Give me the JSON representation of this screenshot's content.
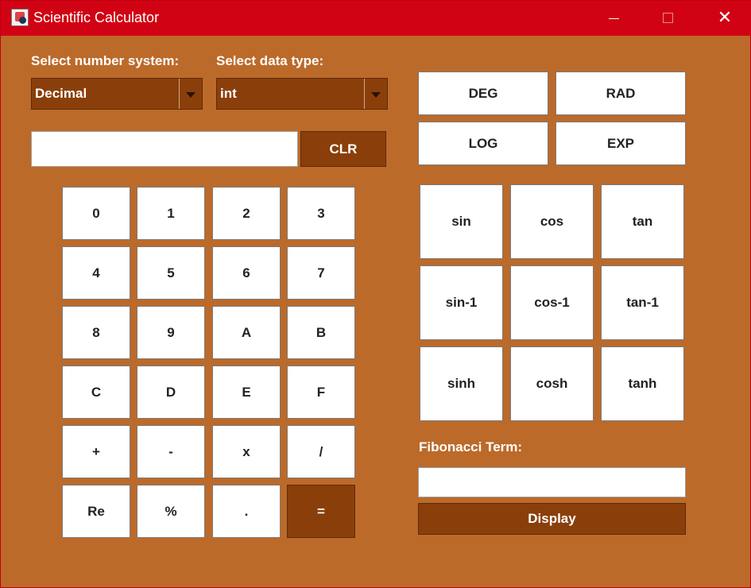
{
  "window": {
    "title": "Scientific Calculator",
    "minimize": "—",
    "maximize": "□",
    "close": "✕"
  },
  "selectors": {
    "number_system": {
      "label": "Select number system:",
      "value": "Decimal"
    },
    "data_type": {
      "label": "Select data type:",
      "value": "int"
    }
  },
  "display": {
    "value": "",
    "clear_label": "CLR"
  },
  "keypad": [
    [
      "0",
      "1",
      "2",
      "3"
    ],
    [
      "4",
      "5",
      "6",
      "7"
    ],
    [
      "8",
      "9",
      "A",
      "B"
    ],
    [
      "C",
      "D",
      "E",
      "F"
    ],
    [
      "+",
      "-",
      "x",
      "/"
    ],
    [
      "Re",
      "%",
      ".",
      "="
    ]
  ],
  "modes": {
    "deg": "DEG",
    "rad": "RAD",
    "log": "LOG",
    "exp": "EXP"
  },
  "trig": [
    [
      "sin",
      "cos",
      "tan"
    ],
    [
      "sin-1",
      "cos-1",
      "tan-1"
    ],
    [
      "sinh",
      "cosh",
      "tanh"
    ]
  ],
  "fibonacci": {
    "label": "Fibonacci Term:",
    "value": "",
    "button": "Display"
  },
  "colors": {
    "titlebar": "#D10213",
    "background": "#BC6A2A",
    "accent": "#8A3F0B",
    "button": "#FFFFFF"
  }
}
